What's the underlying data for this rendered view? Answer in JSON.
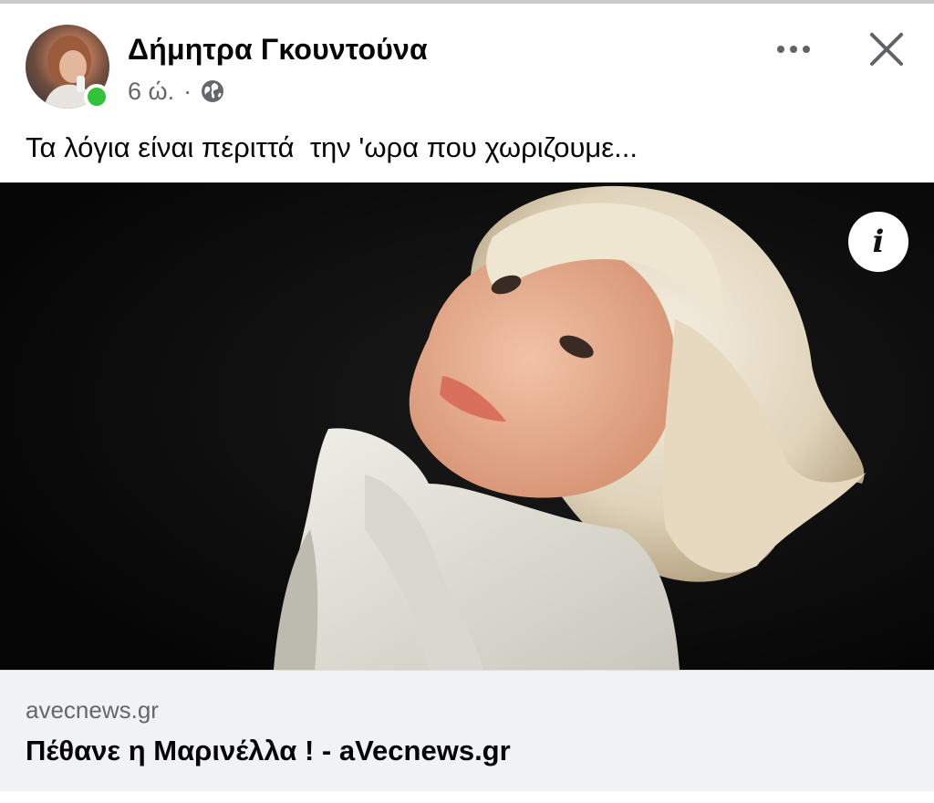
{
  "post": {
    "author_name": "Δήμητρα Γκουντούνα",
    "timestamp": "6 ώ.",
    "separator": "·",
    "privacy_icon": "globe-icon",
    "author_online": true,
    "text": "Τα λόγια είναι περιττά  την 'ωρα που χωριζουμε..."
  },
  "header_actions": {
    "more_icon": "more-icon",
    "close_icon": "close-icon"
  },
  "image": {
    "info_label": "i"
  },
  "link_preview": {
    "domain": "avecnews.gr",
    "title": "Πέθανε η Μαρινέλλα ! - aVecnews.gr"
  },
  "colors": {
    "online_status": "#31c33a",
    "meta_text": "#65676b",
    "preview_background": "#f0f2f5"
  }
}
